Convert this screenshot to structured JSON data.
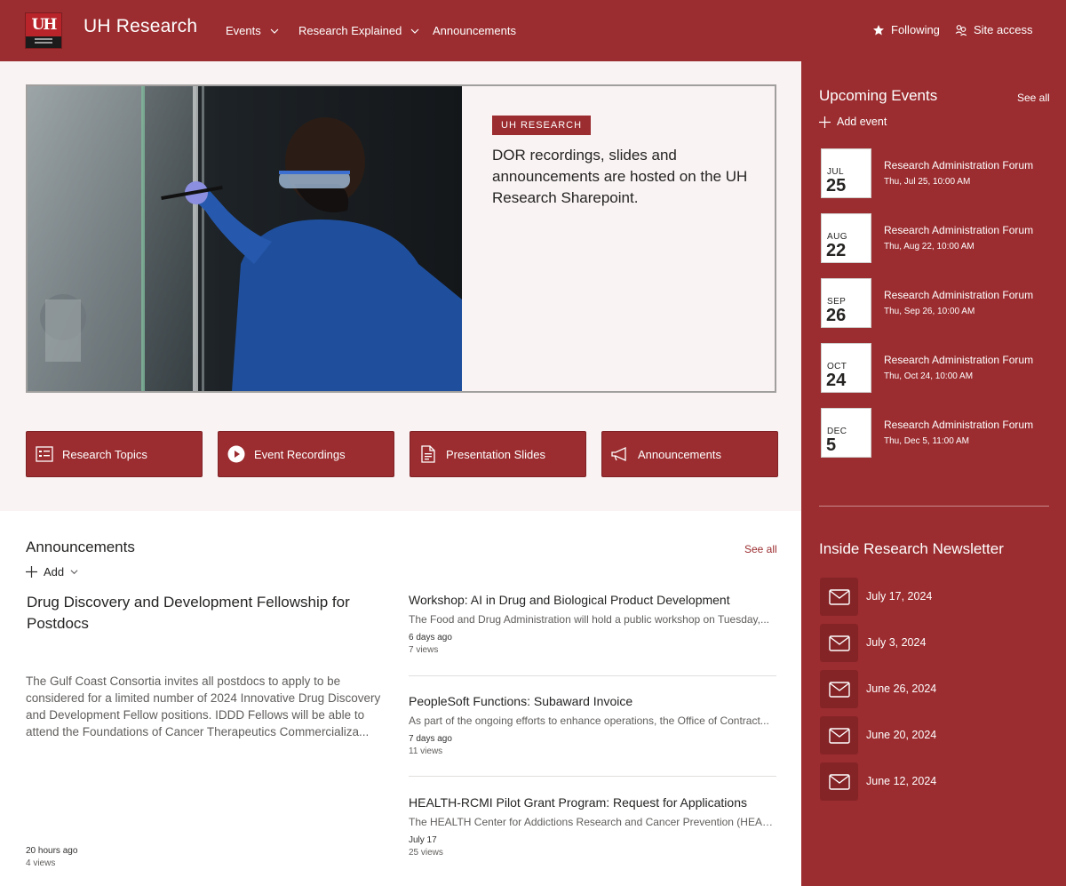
{
  "header": {
    "site_title": "UH Research",
    "logo_text": "UH",
    "nav": [
      {
        "label": "Events",
        "has_dropdown": true
      },
      {
        "label": "Research Explained",
        "has_dropdown": true
      },
      {
        "label": "Announcements",
        "has_dropdown": false
      }
    ],
    "following_label": "Following",
    "site_access_label": "Site access"
  },
  "hero": {
    "tag": "UH RESEARCH",
    "text": "DOR recordings, slides and announcements are hosted on the UH Research Sharepoint."
  },
  "quick_links": [
    {
      "label": "Research Topics",
      "icon": "list-icon"
    },
    {
      "label": "Event Recordings",
      "icon": "play-icon"
    },
    {
      "label": "Presentation Slides",
      "icon": "document-icon"
    },
    {
      "label": "Announcements",
      "icon": "megaphone-icon"
    }
  ],
  "announcements": {
    "title": "Announcements",
    "see_all": "See all",
    "add_label": "Add",
    "featured": {
      "title": "Drug Discovery and Development Fellowship for Postdocs",
      "body": "The Gulf Coast Consortia invites all postdocs to apply to be considered for a limited number of 2024 Innovative Drug Discovery and Development Fellow positions. IDDD Fellows will be able to attend the Foundations of Cancer Therapeutics Commercializa...",
      "time": "20 hours ago",
      "views": "4 views"
    },
    "items": [
      {
        "title": "Workshop: AI in Drug and Biological Product Development",
        "desc": "The Food and Drug Administration will hold a public workshop on Tuesday,...",
        "time": "6 days ago",
        "views": "7 views"
      },
      {
        "title": "PeopleSoft Functions: Subaward Invoice",
        "desc": "As part of the ongoing efforts to enhance operations, the Office of Contract...",
        "time": "7 days ago",
        "views": "11 views"
      },
      {
        "title": "HEALTH-RCMI Pilot Grant Program: Request for Applications",
        "desc": "The HEALTH Center for Addictions Research and Cancer Prevention (HEALT...",
        "time": "July 17",
        "views": "25 views"
      }
    ]
  },
  "events": {
    "title": "Upcoming Events",
    "see_all": "See all",
    "add_label": "Add event",
    "items": [
      {
        "month": "JUL",
        "day": "25",
        "title": "Research Administration Forum",
        "date": "Thu, Jul 25, 10:00 AM"
      },
      {
        "month": "AUG",
        "day": "22",
        "title": "Research Administration Forum",
        "date": "Thu, Aug 22, 10:00 AM"
      },
      {
        "month": "SEP",
        "day": "26",
        "title": "Research Administration Forum",
        "date": "Thu, Sep 26, 10:00 AM"
      },
      {
        "month": "OCT",
        "day": "24",
        "title": "Research Administration Forum",
        "date": "Thu, Oct 24, 10:00 AM"
      },
      {
        "month": "DEC",
        "day": "5",
        "title": "Research Administration Forum",
        "date": "Thu, Dec 5, 11:00 AM"
      }
    ]
  },
  "newsletter": {
    "title": "Inside Research Newsletter",
    "items": [
      {
        "label": "July 17, 2024"
      },
      {
        "label": "July 3, 2024"
      },
      {
        "label": "June 26, 2024"
      },
      {
        "label": "June 20, 2024"
      },
      {
        "label": "June 12, 2024"
      }
    ]
  },
  "colors": {
    "brand": "#9b2c2f",
    "panel": "#f9f3f3"
  }
}
